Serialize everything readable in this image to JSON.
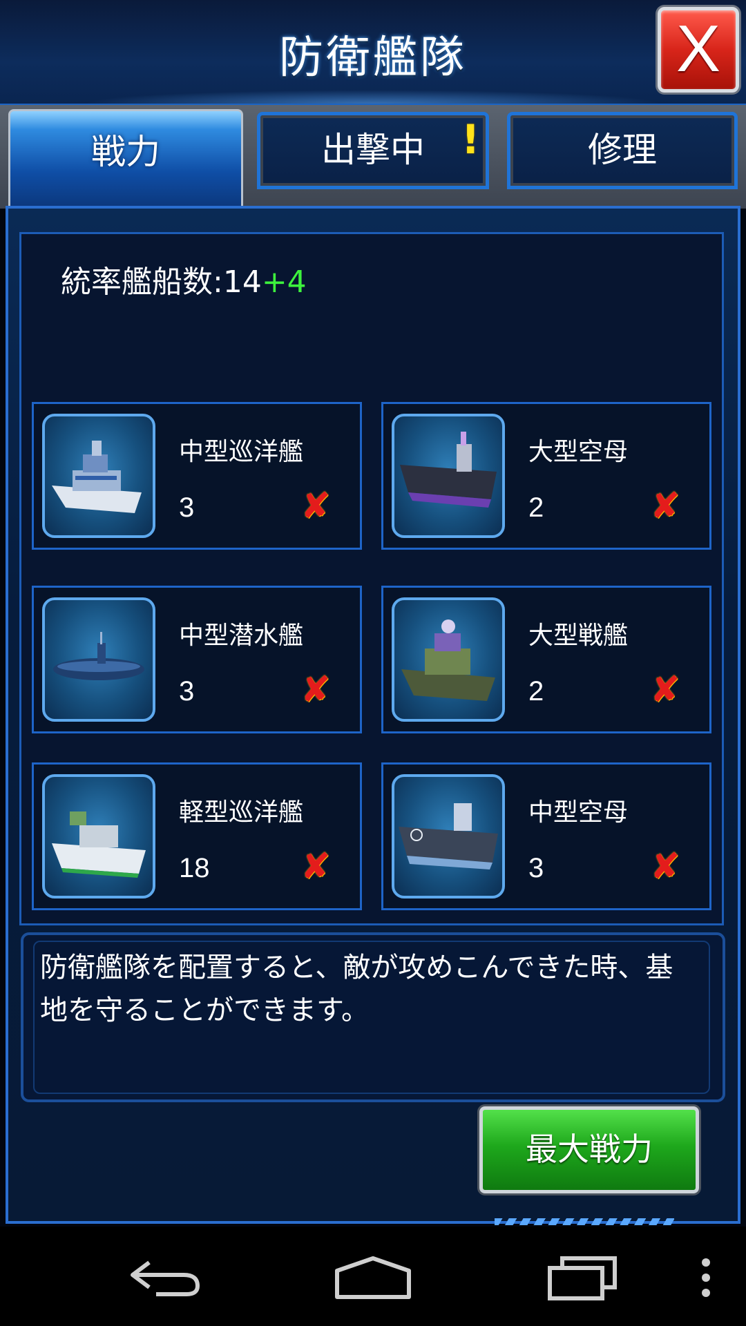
{
  "header": {
    "title": "防衛艦隊",
    "close_label": "X"
  },
  "tabs": [
    {
      "label": "戦力",
      "active": true
    },
    {
      "label": "出撃中",
      "active": false,
      "alert": "!"
    },
    {
      "label": "修理",
      "active": false
    }
  ],
  "fleet": {
    "label": "統率艦船数:14",
    "bonus": "+4"
  },
  "ships": [
    {
      "name": "中型巡洋艦",
      "count": "3",
      "remove": "✘"
    },
    {
      "name": "大型空母",
      "count": "2",
      "remove": "✘"
    },
    {
      "name": "中型潜水艦",
      "count": "3",
      "remove": "✘"
    },
    {
      "name": "大型戦艦",
      "count": "2",
      "remove": "✘"
    },
    {
      "name": "軽型巡洋艦",
      "count": "18",
      "remove": "✘"
    },
    {
      "name": "中型空母",
      "count": "3",
      "remove": "✘"
    }
  ],
  "description": "防衛艦隊を配置すると、敵が攻めこんできた時、基地を守ることができます。",
  "max_button": "最大戦力",
  "colors": {
    "accent": "#1e64c8",
    "bonus": "#3df23d",
    "remove": "#e41c1c",
    "button": "#1ea81c"
  },
  "nav_icons": [
    "back-icon",
    "home-icon",
    "recent-apps-icon",
    "overflow-menu-icon"
  ]
}
